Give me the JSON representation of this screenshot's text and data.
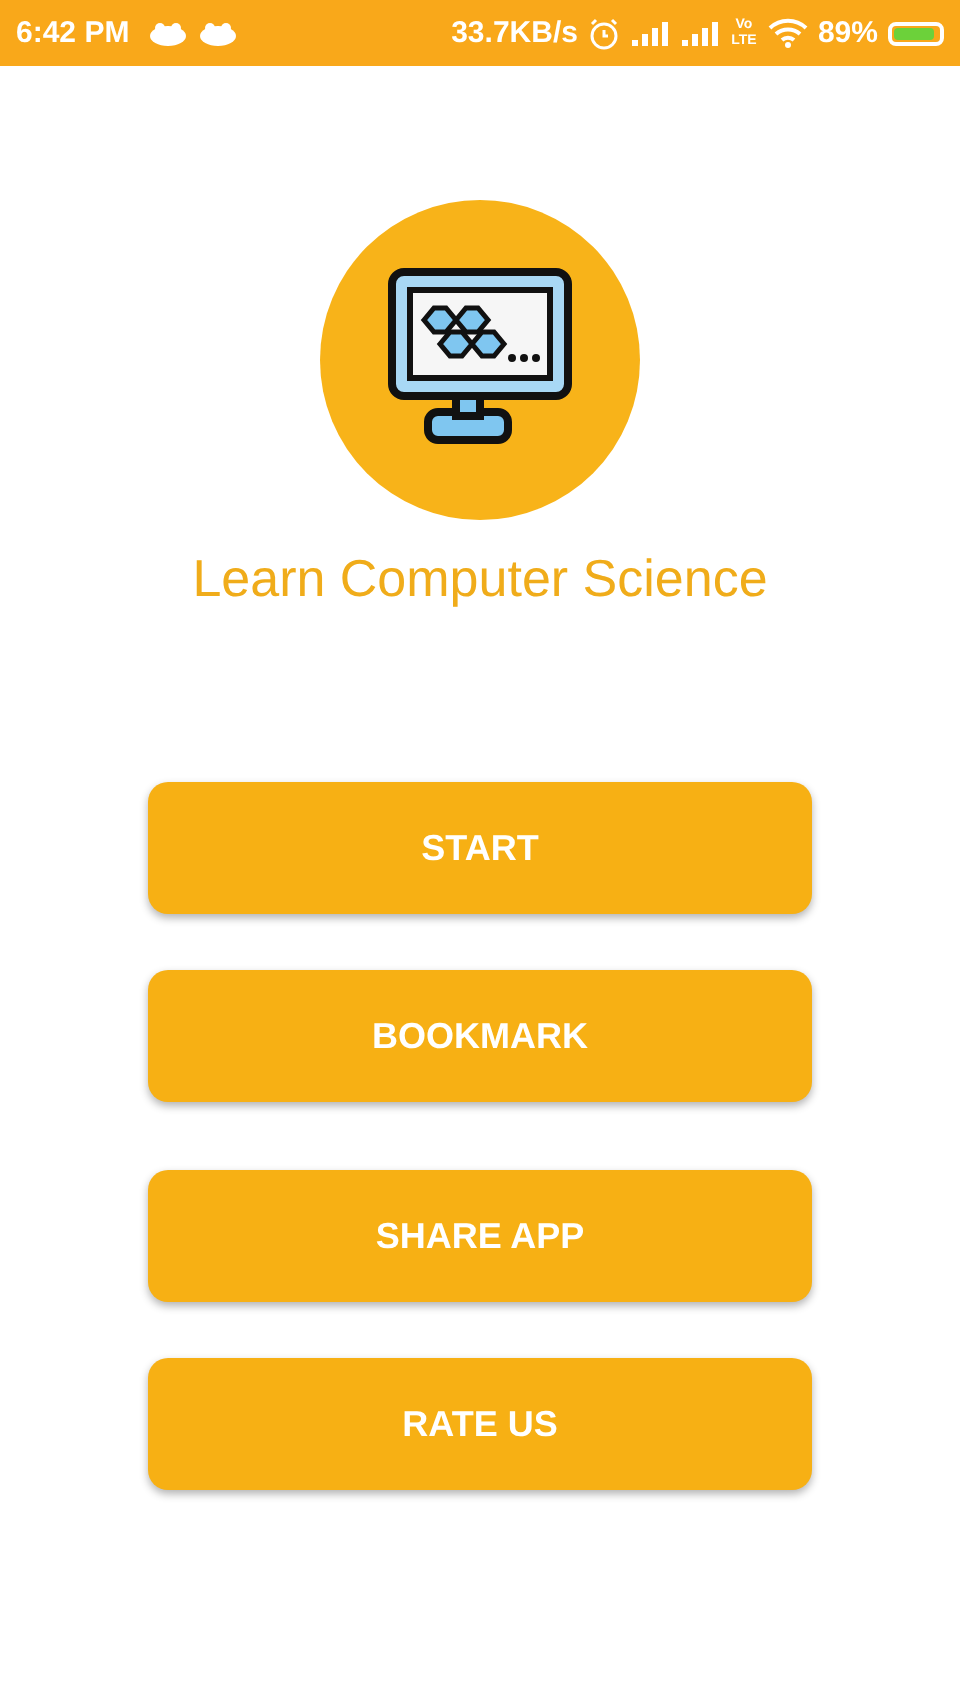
{
  "status_bar": {
    "time": "6:42 PM",
    "speed": "33.7KB/s",
    "volte": "Vo LTE",
    "battery": "89%"
  },
  "title": "Learn Computer Science",
  "buttons": [
    {
      "label": "START"
    },
    {
      "label": "BOOKMARK"
    },
    {
      "label": "SHARE APP"
    },
    {
      "label": "RATE US"
    }
  ]
}
